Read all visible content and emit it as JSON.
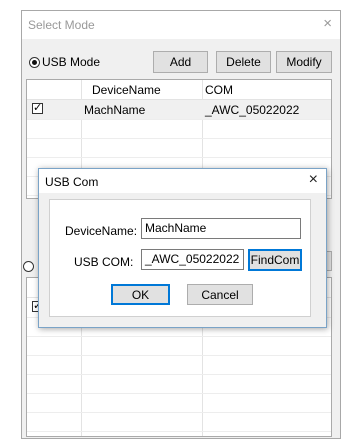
{
  "window": {
    "title": "Select Mode",
    "close_glyph": "×"
  },
  "usb_mode": {
    "label": "USB Mode",
    "add_label": "Add",
    "delete_label": "Delete",
    "modify_label": "Modify"
  },
  "usb_list": {
    "columns": [
      "DeviceName",
      "COM"
    ],
    "rows": [
      {
        "checked": true,
        "device": "MachName",
        "com": "_AWC_05022022"
      }
    ]
  },
  "lower_list": {
    "rows": [
      {
        "checked": true
      }
    ]
  },
  "dialog": {
    "title": "USB Com",
    "close_glyph": "×",
    "device_name_label": "DeviceName:",
    "device_name_value": "MachName",
    "usb_com_label": "USB COM:",
    "usb_com_value": "_AWC_05022022",
    "findcom_label": "FindCom",
    "ok_label": "OK",
    "cancel_label": "Cancel"
  },
  "check_glyph": "✓"
}
